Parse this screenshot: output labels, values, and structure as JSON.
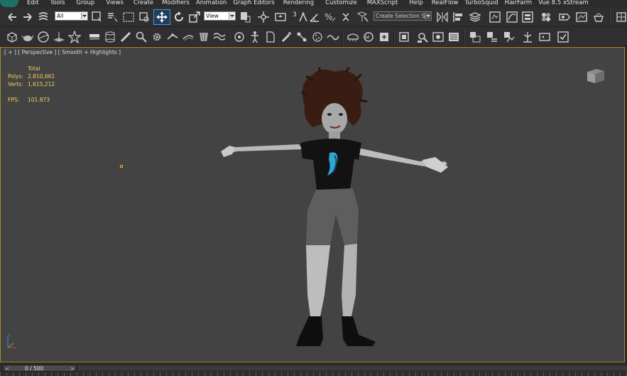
{
  "menu": {
    "items": [
      "Edit",
      "Tools",
      "Group",
      "Views",
      "Create",
      "Modifiers",
      "Animation",
      "Graph Editors",
      "Rendering",
      "Customize",
      "MAXScript",
      "Help",
      "RealFlow",
      "TurboSquid",
      "HairFarm",
      "Vue 8.5 xStream"
    ]
  },
  "toolbar1": {
    "selection_filter": "All",
    "reference_coord": "View",
    "snap_value": "3",
    "named_selection_placeholder": "Create Selection Se"
  },
  "viewport": {
    "label": "[ + ] [ Perspective ] [ Smooth + Highlights ]",
    "stats": {
      "header": "Total",
      "polys_label": "Polys:",
      "polys_value": "2,810,661",
      "verts_label": "Verts:",
      "verts_value": "1,615,212",
      "fps_label": "FPS:",
      "fps_value": "101.873"
    }
  },
  "timeline": {
    "frame_display": "0 / 500",
    "prev_arrow": "<",
    "next_arrow": ">"
  },
  "colors": {
    "viewport_bg": "#434343",
    "viewport_border_active": "#a68a24",
    "stats_text": "#f2d15a",
    "toolbar_bg": "#2f2f2f"
  }
}
